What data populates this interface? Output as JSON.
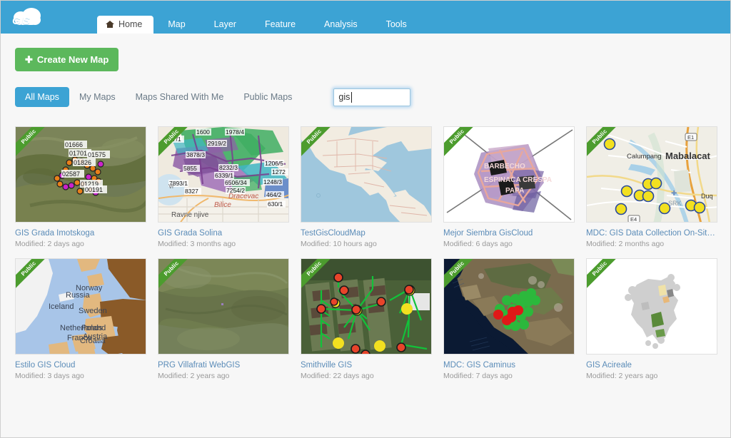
{
  "header": {
    "logo_text": "GIS",
    "logo_icon": "cloud-icon",
    "tabs": [
      {
        "label": "Home",
        "icon": "home-icon",
        "active": true
      },
      {
        "label": "Map",
        "active": false
      },
      {
        "label": "Layer",
        "active": false
      },
      {
        "label": "Feature",
        "active": false
      },
      {
        "label": "Analysis",
        "active": false
      },
      {
        "label": "Tools",
        "active": false
      }
    ]
  },
  "toolbar": {
    "create_label": "Create New Map",
    "create_icon": "plus-icon"
  },
  "filters": {
    "items": [
      {
        "label": "All Maps",
        "active": true
      },
      {
        "label": "My Maps",
        "active": false
      },
      {
        "label": "Maps Shared With Me",
        "active": false
      },
      {
        "label": "Public Maps",
        "active": false
      }
    ]
  },
  "search": {
    "value": "gis",
    "placeholder": ""
  },
  "colors": {
    "brand_blue": "#3ca3d4",
    "green_button": "#5cb85c",
    "ribbon_green": "#4c9c2e",
    "title_link": "#5b8cb8",
    "page_bg": "#f7f7f7"
  },
  "cards": [
    {
      "title": "GIS Grada Imotskoga",
      "modified": "Modified: 2 days ago",
      "badge": "Public",
      "thumb_kind": "satellite-points",
      "labels": [
        "01666",
        "01701",
        "01575",
        "01826",
        "02587",
        "01219",
        "00191"
      ]
    },
    {
      "title": "GIS Grada Solina",
      "modified": "Modified: 3 months ago",
      "badge": "Public",
      "thumb_kind": "cadastral-parcels",
      "labels": [
        "1600",
        "1978/4",
        "97/1",
        "2919/2",
        "3878/3",
        "5855",
        "8232/3",
        "1206/5",
        "6339/1",
        "1272",
        "7893/1",
        "8327",
        "6506/34",
        "7254/2",
        "1248/3",
        "464/2",
        "630/1",
        "Dracevac",
        "Bilice",
        "Ravne njive",
        "Vr"
      ]
    },
    {
      "title": "TestGisCloudMap",
      "modified": "Modified: 10 hours ago",
      "badge": "Public",
      "thumb_kind": "world-basemap",
      "labels": []
    },
    {
      "title": "Mejor Siembra GisCloud",
      "modified": "Modified: 6 days ago",
      "badge": "Public",
      "thumb_kind": "crop-field",
      "labels": [
        "BARBECHO",
        "ESPINACA CRESPA",
        "PAPA"
      ]
    },
    {
      "title": "MDC: GIS Data Collection On-Site - ...",
      "modified": "Modified: 2 months ago",
      "badge": "Public",
      "thumb_kind": "road-map-markers",
      "labels": [
        "Calumpang",
        "Mabalacat",
        "E1",
        "E4",
        "SRK",
        "Duq"
      ]
    },
    {
      "title": "Estilo GIS Cloud",
      "modified": "Modified: 3 days ago",
      "badge": "Public",
      "thumb_kind": "europe-choropleth",
      "labels": [
        "Norway",
        "Russia",
        "Iceland",
        "Sweden",
        "Netherlands",
        "Poland",
        "France",
        "Austria",
        "Croatia"
      ]
    },
    {
      "title": "PRG Villafrati WebGIS",
      "modified": "Modified: 2 years ago",
      "badge": "Public",
      "thumb_kind": "terrain-satellite",
      "labels": []
    },
    {
      "title": "Smithville GIS",
      "modified": "Modified: 22 days ago",
      "badge": "Public",
      "thumb_kind": "utility-network",
      "labels": []
    },
    {
      "title": "MDC: GIS Caminus",
      "modified": "Modified: 7 days ago",
      "badge": "Public",
      "thumb_kind": "coastal-clusters",
      "labels": []
    },
    {
      "title": "GIS Acireale",
      "modified": "Modified: 2 years ago",
      "badge": "Public",
      "thumb_kind": "parcel-outline",
      "labels": []
    }
  ]
}
